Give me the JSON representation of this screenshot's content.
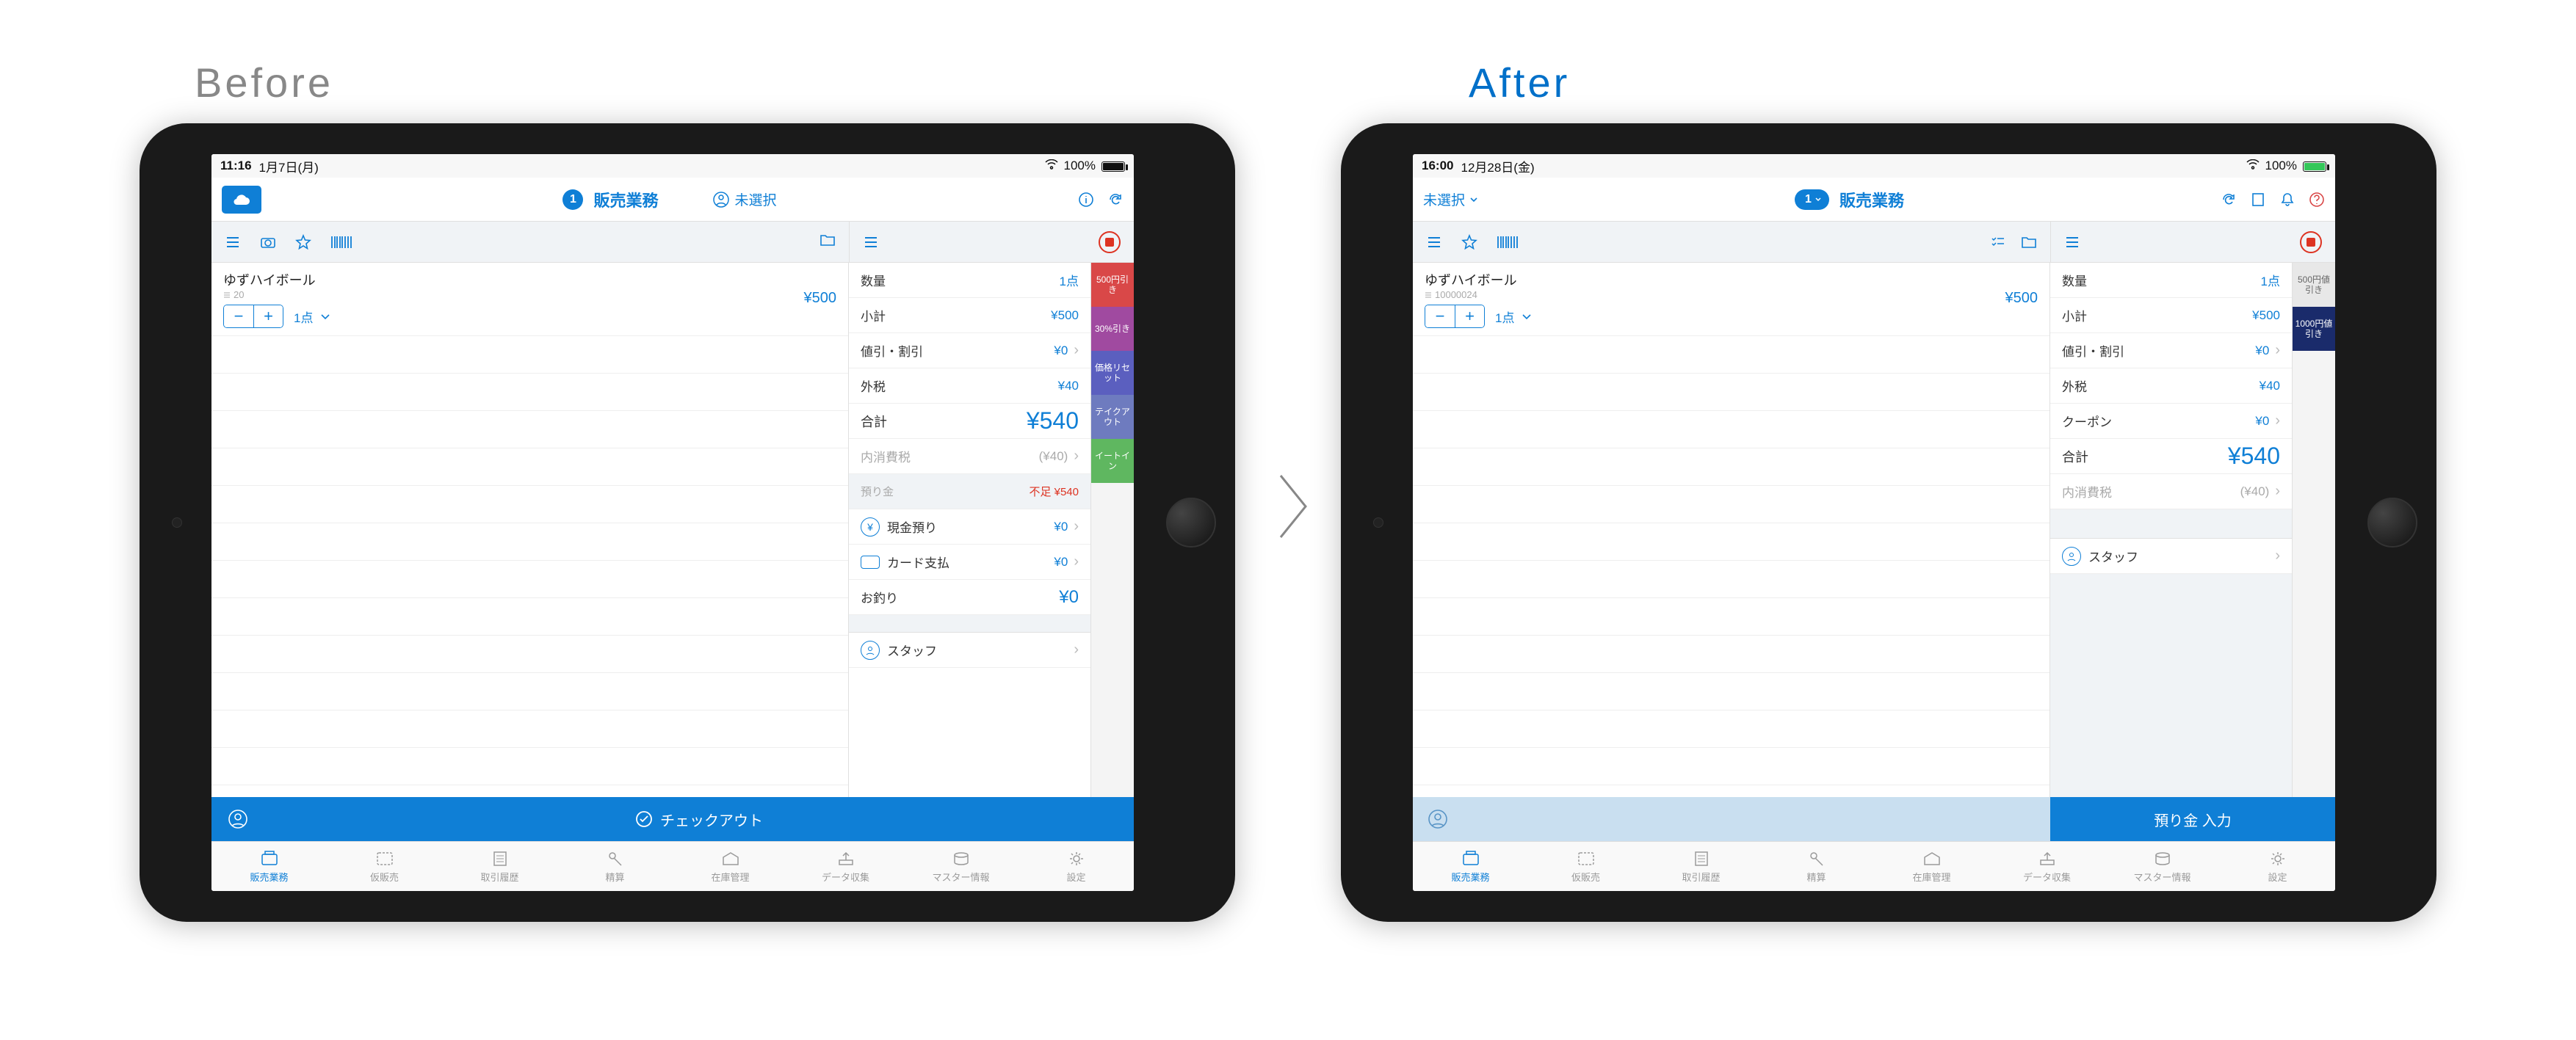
{
  "labels": {
    "before": "Before",
    "after": "After"
  },
  "before": {
    "status": {
      "time": "11:16",
      "date": "1月7日(月)",
      "battery_pct": "100%"
    },
    "header": {
      "badge": "1",
      "title": "販売業務",
      "staff_unselected": "未選択"
    },
    "item": {
      "name": "ゆずハイボール",
      "code": "20",
      "qty_label": "1点",
      "price": "¥500"
    },
    "summary": {
      "qty_label": "数量",
      "qty_val": "1点",
      "subtotal_label": "小計",
      "subtotal_val": "¥500",
      "discount_label": "値引・割引",
      "discount_val": "¥0",
      "tax_label": "外税",
      "tax_val": "¥40",
      "total_label": "合計",
      "total_val": "¥540",
      "innertax_label": "内消費税",
      "innertax_val": "(¥40)",
      "deposit_label": "預り金",
      "deposit_shortage": "不足 ¥540",
      "cash_label": "現金預り",
      "cash_val": "¥0",
      "card_label": "カード支払",
      "card_val": "¥0",
      "change_label": "お釣り",
      "change_val": "¥0",
      "staff_label": "スタッフ"
    },
    "tags": [
      "500円引き",
      "30%引き",
      "価格リセット",
      "テイクアウト",
      "イートイン"
    ],
    "checkout_label": "チェックアウト"
  },
  "after": {
    "status": {
      "time": "16:00",
      "date": "12月28日(金)",
      "battery_pct": "100%"
    },
    "header": {
      "dropdown_label": "未選択",
      "badge": "1",
      "title": "販売業務"
    },
    "item": {
      "name": "ゆずハイボール",
      "code": "10000024",
      "qty_label": "1点",
      "price": "¥500"
    },
    "summary": {
      "qty_label": "数量",
      "qty_val": "1点",
      "subtotal_label": "小計",
      "subtotal_val": "¥500",
      "discount_label": "値引・割引",
      "discount_val": "¥0",
      "tax_label": "外税",
      "tax_val": "¥40",
      "coupon_label": "クーポン",
      "coupon_val": "¥0",
      "total_label": "合計",
      "total_val": "¥540",
      "innertax_label": "内消費税",
      "innertax_val": "(¥40)",
      "staff_label": "スタッフ"
    },
    "tags": [
      "500円値引き",
      "1000円値引き"
    ],
    "checkout_label": "預り金 入力"
  },
  "tabs": [
    "販売業務",
    "仮販売",
    "取引履歴",
    "精算",
    "在庫管理",
    "データ収集",
    "マスター情報",
    "設定"
  ]
}
